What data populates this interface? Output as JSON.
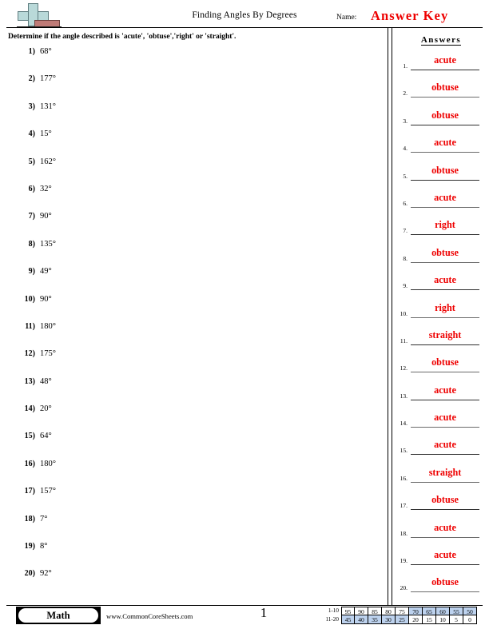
{
  "header": {
    "title": "Finding Angles By Degrees",
    "name_label": "Name:",
    "answer_key": "Answer Key",
    "logo_icon": "math-cross-logo"
  },
  "instruction": "Determine if the angle described is 'acute', 'obtuse','right' or 'straight'.",
  "answers_header": "Answers",
  "problems": [
    {
      "number": "1)",
      "value": "68°"
    },
    {
      "number": "2)",
      "value": "177°"
    },
    {
      "number": "3)",
      "value": "131°"
    },
    {
      "number": "4)",
      "value": "15°"
    },
    {
      "number": "5)",
      "value": "162°"
    },
    {
      "number": "6)",
      "value": "32°"
    },
    {
      "number": "7)",
      "value": "90°"
    },
    {
      "number": "8)",
      "value": "135°"
    },
    {
      "number": "9)",
      "value": "49°"
    },
    {
      "number": "10)",
      "value": "90°"
    },
    {
      "number": "11)",
      "value": "180°"
    },
    {
      "number": "12)",
      "value": "175°"
    },
    {
      "number": "13)",
      "value": "48°"
    },
    {
      "number": "14)",
      "value": "20°"
    },
    {
      "number": "15)",
      "value": "64°"
    },
    {
      "number": "16)",
      "value": "180°"
    },
    {
      "number": "17)",
      "value": "157°"
    },
    {
      "number": "18)",
      "value": "7°"
    },
    {
      "number": "19)",
      "value": "8°"
    },
    {
      "number": "20)",
      "value": "92°"
    }
  ],
  "answers": [
    {
      "number": "1.",
      "value": "acute"
    },
    {
      "number": "2.",
      "value": "obtuse"
    },
    {
      "number": "3.",
      "value": "obtuse"
    },
    {
      "number": "4.",
      "value": "acute"
    },
    {
      "number": "5.",
      "value": "obtuse"
    },
    {
      "number": "6.",
      "value": "acute"
    },
    {
      "number": "7.",
      "value": "right"
    },
    {
      "number": "8.",
      "value": "obtuse"
    },
    {
      "number": "9.",
      "value": "acute"
    },
    {
      "number": "10.",
      "value": "right"
    },
    {
      "number": "11.",
      "value": "straight"
    },
    {
      "number": "12.",
      "value": "obtuse"
    },
    {
      "number": "13.",
      "value": "acute"
    },
    {
      "number": "14.",
      "value": "acute"
    },
    {
      "number": "15.",
      "value": "acute"
    },
    {
      "number": "16.",
      "value": "straight"
    },
    {
      "number": "17.",
      "value": "obtuse"
    },
    {
      "number": "18.",
      "value": "acute"
    },
    {
      "number": "19.",
      "value": "acute"
    },
    {
      "number": "20.",
      "value": "obtuse"
    }
  ],
  "footer": {
    "subject_badge": "Math",
    "site_url": "www.CommonCoreSheets.com",
    "page_number": "1"
  },
  "score_table": {
    "rows": [
      {
        "label": "1-10",
        "cells": [
          {
            "value": "95",
            "shaded": false
          },
          {
            "value": "90",
            "shaded": false
          },
          {
            "value": "85",
            "shaded": false
          },
          {
            "value": "80",
            "shaded": false
          },
          {
            "value": "75",
            "shaded": false
          },
          {
            "value": "70",
            "shaded": true
          },
          {
            "value": "65",
            "shaded": true
          },
          {
            "value": "60",
            "shaded": true
          },
          {
            "value": "55",
            "shaded": true
          },
          {
            "value": "50",
            "shaded": true
          }
        ]
      },
      {
        "label": "11-20",
        "cells": [
          {
            "value": "45",
            "shaded": true
          },
          {
            "value": "40",
            "shaded": true
          },
          {
            "value": "35",
            "shaded": true
          },
          {
            "value": "30",
            "shaded": true
          },
          {
            "value": "25",
            "shaded": true
          },
          {
            "value": "20",
            "shaded": false
          },
          {
            "value": "15",
            "shaded": false
          },
          {
            "value": "10",
            "shaded": false
          },
          {
            "value": "5",
            "shaded": false
          },
          {
            "value": "0",
            "shaded": false
          }
        ]
      }
    ]
  },
  "colors": {
    "answer_red": "#ee0000",
    "shade_blue": "#bdd2ee",
    "logo_teal": "#b9d9d9",
    "logo_rose": "#bf7b77"
  }
}
